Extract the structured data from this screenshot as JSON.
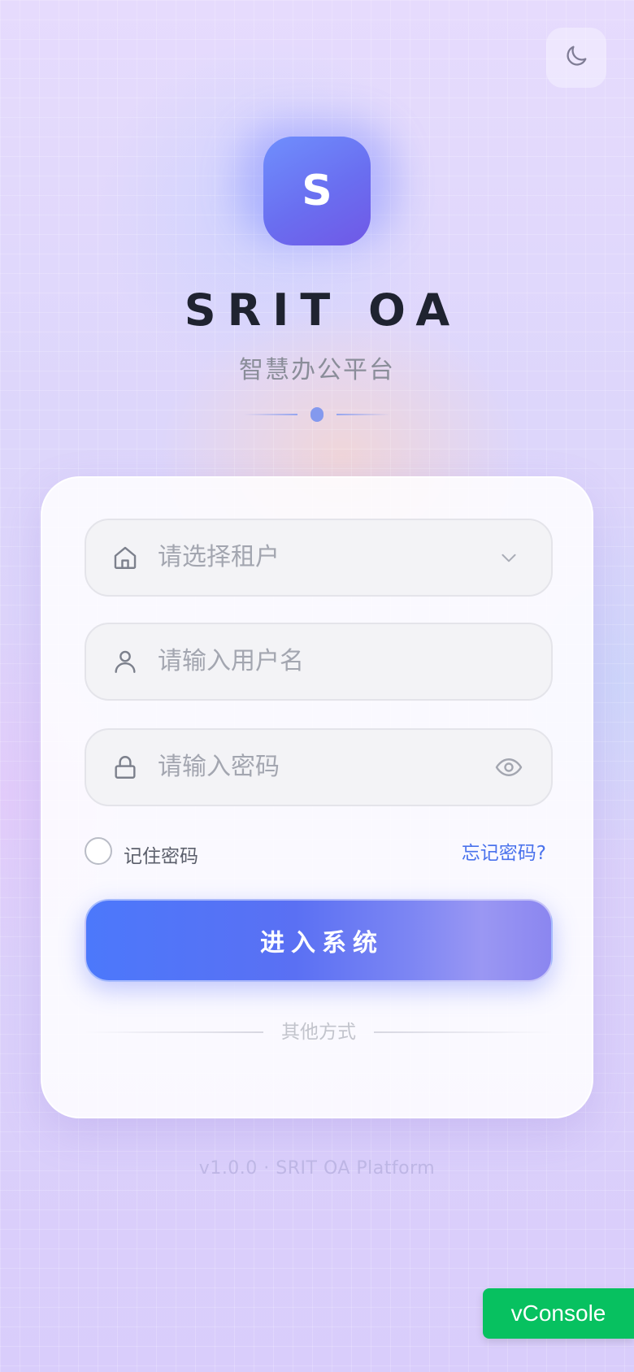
{
  "brand": {
    "logo_letter": "S",
    "title": "SRIT OA",
    "subtitle": "智慧办公平台"
  },
  "theme_toggle": {
    "icon": "moon-icon"
  },
  "login_form": {
    "tenant_select": {
      "placeholder": "请选择租户",
      "icon": "home-icon",
      "trailing_icon": "chevron-down-icon"
    },
    "username_field": {
      "placeholder": "请输入用户名",
      "icon": "user-icon"
    },
    "password_field": {
      "placeholder": "请输入密码",
      "icon": "lock-icon",
      "trailing_icon": "eye-icon"
    },
    "remember_label": "记住密码",
    "remember_checked": false,
    "forgot_link": "忘记密码?",
    "submit_label": "进入系统",
    "other_methods_label": "其他方式"
  },
  "footer": {
    "text": "v1.0.0 · SRIT OA Platform"
  },
  "vconsole": {
    "label": "vConsole"
  },
  "colors": {
    "accent": "#4a72ec",
    "button_start": "#4c78fb",
    "button_end": "#9a97f3",
    "vconsole_green": "#07c160"
  }
}
